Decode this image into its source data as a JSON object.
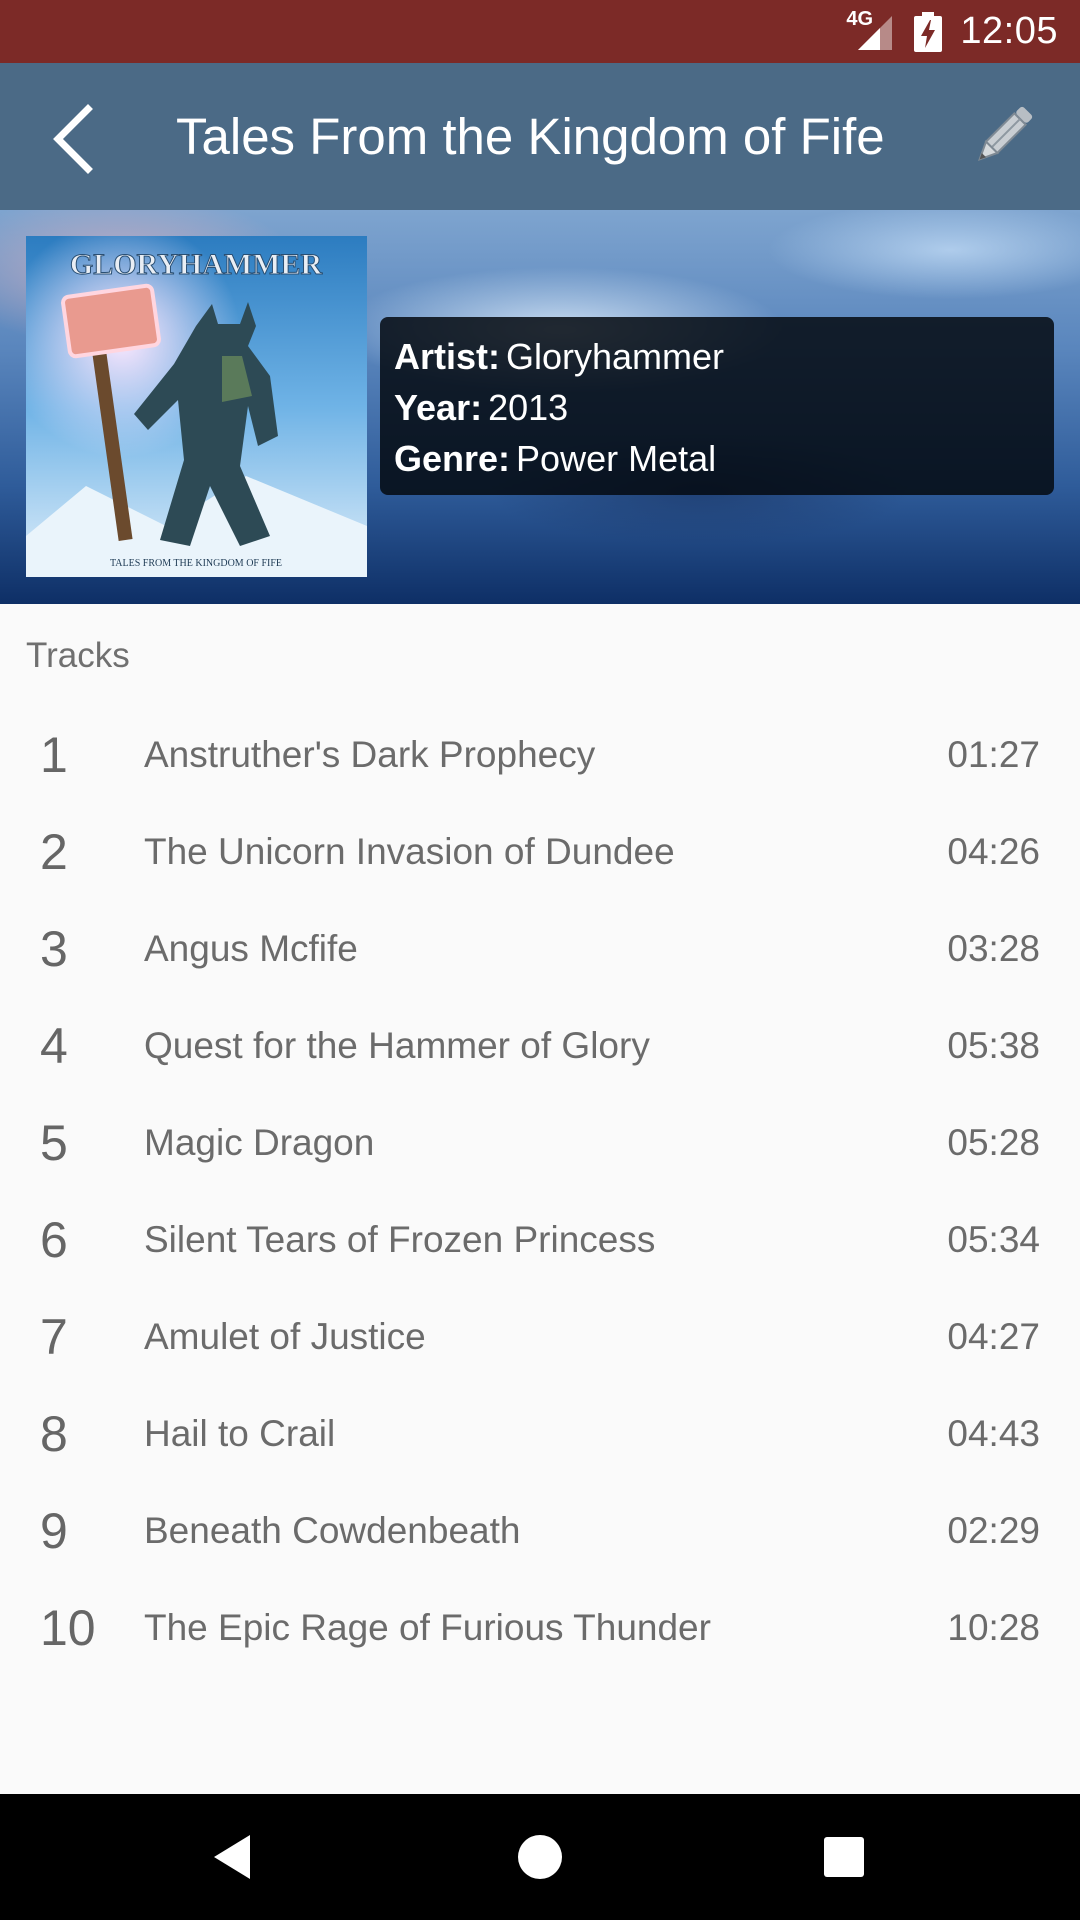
{
  "status_bar": {
    "network": "4G",
    "time": "12:05"
  },
  "app_bar": {
    "title": "Tales From the Kingdom of Fife",
    "back_icon": "back-arrow-icon",
    "edit_icon": "pencil-icon"
  },
  "album": {
    "cover_brand": "GLORYHAMMER",
    "cover_subtitle": "TALES FROM THE KINGDOM OF FIFE",
    "artist_label": "Artist:",
    "artist": "Gloryhammer",
    "year_label": "Year:",
    "year": "2013",
    "genre_label": "Genre:",
    "genre": "Power Metal"
  },
  "tracks_header": "Tracks",
  "tracks": [
    {
      "number": "1",
      "title": "Anstruther's Dark Prophecy",
      "duration": "01:27"
    },
    {
      "number": "2",
      "title": "The Unicorn Invasion of Dundee",
      "duration": "04:26"
    },
    {
      "number": "3",
      "title": "Angus Mcfife",
      "duration": "03:28"
    },
    {
      "number": "4",
      "title": "Quest for the Hammer of Glory",
      "duration": "05:38"
    },
    {
      "number": "5",
      "title": "Magic Dragon",
      "duration": "05:28"
    },
    {
      "number": "6",
      "title": "Silent Tears of Frozen Princess",
      "duration": "05:34"
    },
    {
      "number": "7",
      "title": "Amulet of Justice",
      "duration": "04:27"
    },
    {
      "number": "8",
      "title": "Hail to Crail",
      "duration": "04:43"
    },
    {
      "number": "9",
      "title": "Beneath Cowdenbeath",
      "duration": "02:29"
    },
    {
      "number": "10",
      "title": "The Epic Rage of Furious Thunder",
      "duration": "10:28"
    }
  ],
  "nav_bar": {
    "back": "nav-back-icon",
    "home": "nav-home-icon",
    "recents": "nav-recents-icon"
  },
  "colors": {
    "status_bar": "#7c2a27",
    "app_bar": "#4b6a86",
    "background": "#fafafa",
    "text_secondary": "#6b6b6b"
  }
}
